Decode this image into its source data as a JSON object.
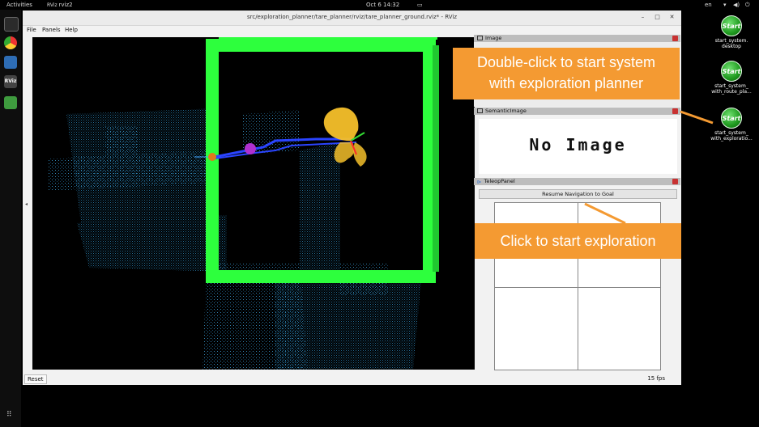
{
  "topbar": {
    "activities": "Activities",
    "app_name": "rviz2",
    "clock": "Oct 6  14:32",
    "lang": "en"
  },
  "desktop": {
    "shortcuts": [
      {
        "logo": "Start",
        "label": "start_system.\ndesktop"
      },
      {
        "logo": "Start",
        "label": "start_system_\nwith_route_pla..."
      },
      {
        "logo": "Start",
        "label": "start_system_\nwith_exploratio..."
      }
    ]
  },
  "window": {
    "title": "src/exploration_planner/tare_planner/rviz/tare_planner_ground.rviz* - RViz",
    "menu": [
      "File",
      "Panels",
      "Help"
    ],
    "status_left": "Reset",
    "status_right": "15 fps"
  },
  "panels": {
    "image_title": "Image",
    "semantic_title": "SemanticImage",
    "semantic_placeholder": "No Image",
    "teleop_title": "TeleopPanel",
    "resume_button": "Resume Navigation to Goal"
  },
  "annotations": {
    "callout_top_line1": "Double-click to start system",
    "callout_top_line2": "with exploration planner",
    "callout_bottom": "Click to start exploration"
  },
  "colors": {
    "boundary": "#2dff3d",
    "path": "#2a44ff",
    "robot_marker": "#b030d0",
    "frontier": "#f5c02a",
    "callout": "#f49a32",
    "point_cloud": "#2a7fb0"
  }
}
